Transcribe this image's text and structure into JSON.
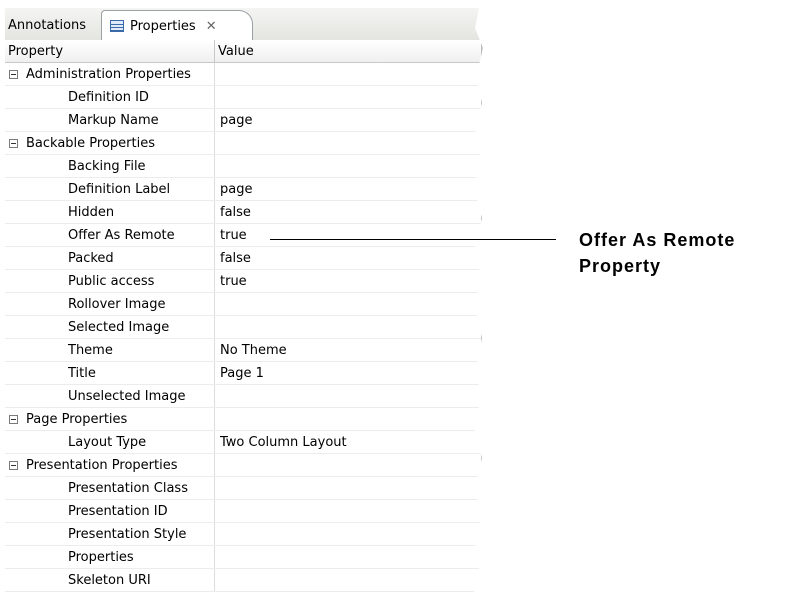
{
  "tabs": [
    {
      "label": "Annotations",
      "active": false
    },
    {
      "label": "Properties",
      "active": true,
      "close_glyph": "✕"
    }
  ],
  "columns": {
    "property": "Property",
    "value": "Value"
  },
  "rows": [
    {
      "kind": "category",
      "property": "Administration Properties",
      "value": ""
    },
    {
      "kind": "property",
      "property": "Definition ID",
      "value": ""
    },
    {
      "kind": "property",
      "property": "Markup Name",
      "value": "page"
    },
    {
      "kind": "category",
      "property": "Backable Properties",
      "value": ""
    },
    {
      "kind": "property",
      "property": "Backing File",
      "value": ""
    },
    {
      "kind": "property",
      "property": "Definition Label",
      "value": "page"
    },
    {
      "kind": "property",
      "property": "Hidden",
      "value": "false"
    },
    {
      "kind": "property",
      "property": "Offer As Remote",
      "value": "true"
    },
    {
      "kind": "property",
      "property": "Packed",
      "value": "false"
    },
    {
      "kind": "property",
      "property": "Public access",
      "value": "true"
    },
    {
      "kind": "property",
      "property": "Rollover Image",
      "value": ""
    },
    {
      "kind": "property",
      "property": "Selected Image",
      "value": ""
    },
    {
      "kind": "property",
      "property": "Theme",
      "value": "No Theme"
    },
    {
      "kind": "property",
      "property": "Title",
      "value": "Page 1"
    },
    {
      "kind": "property",
      "property": "Unselected Image",
      "value": ""
    },
    {
      "kind": "category",
      "property": "Page Properties",
      "value": ""
    },
    {
      "kind": "property",
      "property": "Layout Type",
      "value": "Two Column Layout"
    },
    {
      "kind": "category",
      "property": "Presentation Properties",
      "value": ""
    },
    {
      "kind": "property",
      "property": "Presentation Class",
      "value": ""
    },
    {
      "kind": "property",
      "property": "Presentation ID",
      "value": ""
    },
    {
      "kind": "property",
      "property": "Presentation Style",
      "value": ""
    },
    {
      "kind": "property",
      "property": "Properties",
      "value": ""
    },
    {
      "kind": "property",
      "property": "Skeleton URI",
      "value": ""
    }
  ],
  "callout": {
    "line1": "Offer As Remote",
    "line2": "Property"
  }
}
